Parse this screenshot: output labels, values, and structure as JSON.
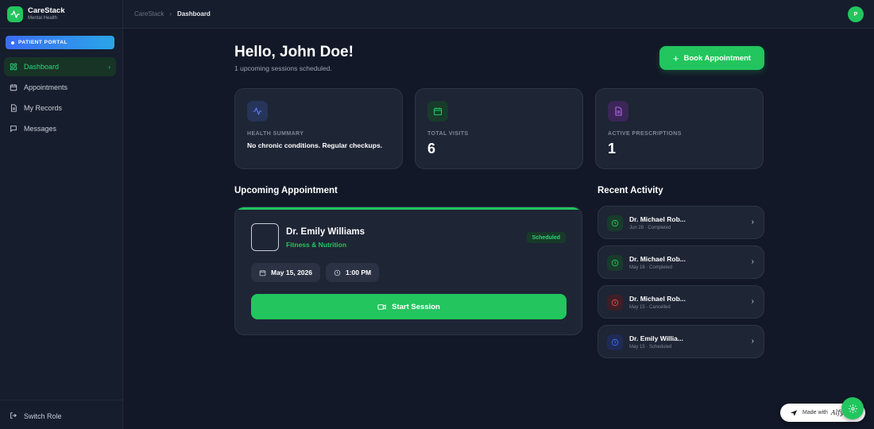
{
  "brand": {
    "name": "CareStack",
    "subtitle": "Mental Health",
    "icon": "activity-pulse-icon"
  },
  "sidebar": {
    "portal_badge": "PATIENT PORTAL",
    "items": [
      {
        "label": "Dashboard",
        "icon": "dashboard-grid-icon",
        "active": true
      },
      {
        "label": "Appointments",
        "icon": "calendar-icon",
        "active": false
      },
      {
        "label": "My Records",
        "icon": "document-icon",
        "active": false
      },
      {
        "label": "Messages",
        "icon": "chat-bubble-icon",
        "active": false
      }
    ],
    "switch_role": "Switch Role"
  },
  "topbar": {
    "breadcrumb": [
      "CareStack",
      "Dashboard"
    ],
    "avatar_initial": "P"
  },
  "header": {
    "greeting": "Hello, John Doe!",
    "subtext": "1 upcoming sessions scheduled.",
    "book_button": "Book Appointment"
  },
  "stats": [
    {
      "label": "HEALTH SUMMARY",
      "value": "No chronic conditions. Regular checkups.",
      "icon": "activity-pulse-icon",
      "color": "#5b7cf0"
    },
    {
      "label": "TOTAL VISITS",
      "value": "6",
      "icon": "calendar-icon",
      "color": "#22c55e"
    },
    {
      "label": "ACTIVE PRESCRIPTIONS",
      "value": "1",
      "icon": "document-icon",
      "color": "#b565e8"
    }
  ],
  "upcoming": {
    "title": "Upcoming Appointment",
    "doctor": "Dr. Emily Williams",
    "specialty": "Fitness & Nutrition",
    "status": "Scheduled",
    "date": "May 15, 2026",
    "time": "1:00 PM",
    "start_button": "Start Session"
  },
  "activity": {
    "title": "Recent Activity",
    "items": [
      {
        "name": "Dr. Michael Rob...",
        "meta": "Jun 28 · Completed",
        "status": "completed"
      },
      {
        "name": "Dr. Michael Rob...",
        "meta": "May 16 · Completed",
        "status": "completed"
      },
      {
        "name": "Dr. Michael Rob...",
        "meta": "May 15 · Cancelled",
        "status": "cancelled"
      },
      {
        "name": "Dr. Emily Willia...",
        "meta": "May 15 · Scheduled",
        "status": "scheduled"
      }
    ]
  },
  "footer": {
    "made_with": "Made with",
    "made_with_brand": "Alfy"
  },
  "colors": {
    "accent": "#22c55e",
    "background": "#121827",
    "card": "#1e2535",
    "completed": "#22c55e",
    "cancelled": "#e5484d",
    "scheduled": "#3b6cf6"
  }
}
